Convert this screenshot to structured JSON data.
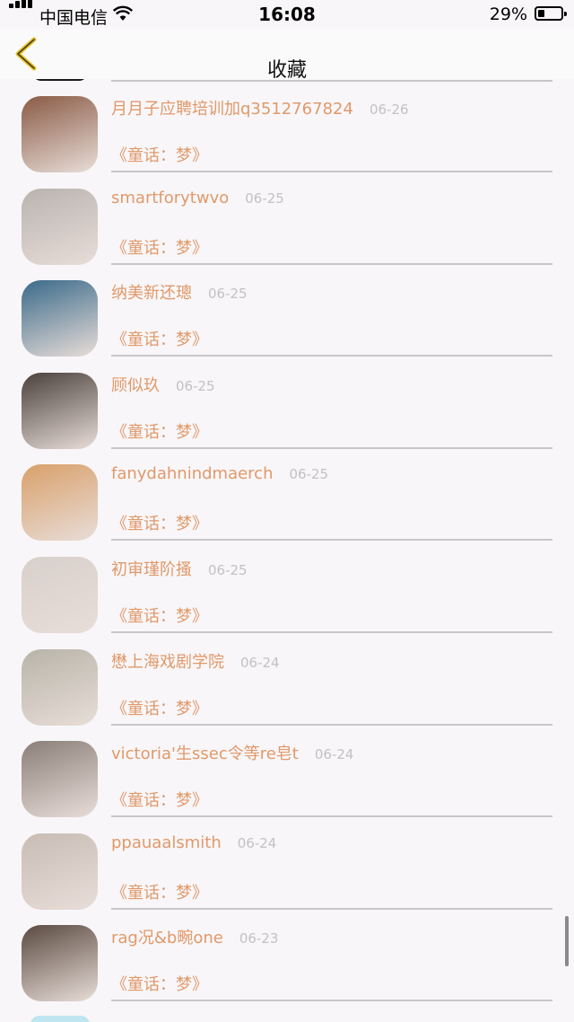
{
  "status_bar": {
    "carrier": "中国电信",
    "time": "16:08",
    "battery": "29%"
  },
  "nav": {
    "title": "收藏",
    "back_icon": "back-arrow-icon"
  },
  "items": [
    {
      "name": "月月子应聘培训加q3512767824",
      "date": "06-26",
      "song": "《童话：梦》",
      "avatar_color": "#8a5a45"
    },
    {
      "name": "smartforytwvo",
      "date": "06-25",
      "song": "《童话：梦》",
      "avatar_color": "#b9b3b0"
    },
    {
      "name": "纳美新还璁",
      "date": "06-25",
      "song": "《童话：梦》",
      "avatar_color": "#3a6a8a"
    },
    {
      "name": "顾似玖",
      "date": "06-25",
      "song": "《童话：梦》",
      "avatar_color": "#4a403c"
    },
    {
      "name": "fanydahnindmaerch",
      "date": "06-25",
      "song": "《童话：梦》",
      "avatar_color": "#d9a06a"
    },
    {
      "name": "初审瑾阶搔",
      "date": "06-25",
      "song": "《童话：梦》",
      "avatar_color": "#d8d0cc"
    },
    {
      "name": "懋上海戏剧学院",
      "date": "06-24",
      "song": "《童话：梦》",
      "avatar_color": "#b8b4a8"
    },
    {
      "name": "victoria'生ssec令等re皂t",
      "date": "06-24",
      "song": "《童话：梦》",
      "avatar_color": "#8a7f78"
    },
    {
      "name": "ppauaalsmith",
      "date": "06-24",
      "song": "《童话：梦》",
      "avatar_color": "#c8bdb5"
    },
    {
      "name": "rag况&b畹one",
      "date": "06-23",
      "song": "《童话：梦》",
      "avatar_color": "#5a4a40"
    }
  ]
}
